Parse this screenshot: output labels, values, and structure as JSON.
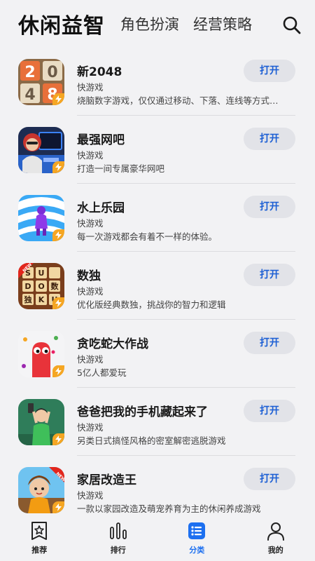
{
  "header": {
    "tabs": [
      {
        "label": "休闲益智",
        "active": true
      },
      {
        "label": "角色扮演",
        "active": false
      },
      {
        "label": "经营策略",
        "active": false
      }
    ],
    "search_icon": "search-icon"
  },
  "apps": [
    {
      "name": "新2048",
      "tag": "快游戏",
      "desc": "烧脑数字游戏，仅仅通过移动、下落、连线等方式…",
      "button": "打开",
      "icon": "2048-icon"
    },
    {
      "name": "最强网吧",
      "tag": "快游戏",
      "desc": "打造一间专属豪华网吧",
      "button": "打开",
      "icon": "internet-cafe-icon"
    },
    {
      "name": "水上乐园",
      "tag": "快游戏",
      "desc": "每一次游戏都会有着不一样的体验。",
      "button": "打开",
      "icon": "water-park-icon"
    },
    {
      "name": "数独",
      "tag": "快游戏",
      "desc": "优化版经典数独，挑战你的智力和逻辑",
      "button": "打开",
      "icon": "sudoku-icon",
      "badge": "NEW"
    },
    {
      "name": "贪吃蛇大作战",
      "tag": "快游戏",
      "desc": "5亿人都爱玩",
      "button": "打开",
      "icon": "snake-icon"
    },
    {
      "name": "爸爸把我的手机藏起来了",
      "tag": "快游戏",
      "desc": "另类日式搞怪风格的密室解密逃脱游戏",
      "button": "打开",
      "icon": "hidden-phone-icon"
    },
    {
      "name": "家居改造王",
      "tag": "快游戏",
      "desc": "一款以家园改造及萌宠养育为主的休闲养成游戏",
      "button": "打开",
      "icon": "home-makeover-icon",
      "badge": "NEW"
    }
  ],
  "bottom_nav": [
    {
      "label": "推荐",
      "icon": "star-icon",
      "active": false
    },
    {
      "label": "排行",
      "icon": "ranking-icon",
      "active": false
    },
    {
      "label": "分类",
      "icon": "category-icon",
      "active": true
    },
    {
      "label": "我的",
      "icon": "profile-icon",
      "active": false
    }
  ],
  "colors": {
    "accent": "#1c6ff0",
    "button_text": "#1c5fd4",
    "button_bg": "#e2e3e8",
    "background": "#f2f2f4",
    "bolt": "#f5a623"
  }
}
